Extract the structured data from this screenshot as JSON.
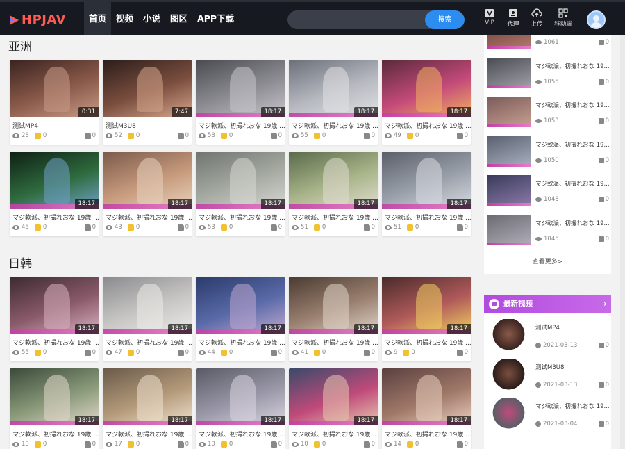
{
  "header": {
    "logo_text": "HPJAV",
    "nav": [
      "首页",
      "视频",
      "小说",
      "图区",
      "APP下载"
    ],
    "active_nav": 0,
    "search": {
      "value": "",
      "placeholder": "",
      "button": "搜索"
    },
    "tools": [
      {
        "icon": "vip-icon",
        "label": "VIP"
      },
      {
        "icon": "agent-icon",
        "label": "代理"
      },
      {
        "icon": "upload-icon",
        "label": "上传"
      },
      {
        "icon": "qrcode-icon",
        "label": "移动端"
      }
    ]
  },
  "sections": [
    {
      "title": "亚洲",
      "cards": [
        {
          "title": "测试MP4",
          "duration": "0:31",
          "views": "28",
          "coins": "0",
          "likes": "0",
          "palette": [
            "#3a2320",
            "#8a5a4a",
            "#c99a86"
          ]
        },
        {
          "title": "测试M3U8",
          "duration": "7:47",
          "views": "52",
          "coins": "0",
          "likes": "0",
          "palette": [
            "#2b1d1a",
            "#7c4f3f",
            "#d5a68d"
          ]
        },
        {
          "title": "マジ軟派、初撮れおな 19歳 ...",
          "duration": "18:17",
          "views": "58",
          "coins": "0",
          "likes": "0",
          "palette": [
            "#4a4a52",
            "#8c8c92",
            "#c9c6cc"
          ]
        },
        {
          "title": "マジ軟派、初撮れおな 19歳 ...",
          "duration": "18:17",
          "views": "55",
          "coins": "0",
          "likes": "0",
          "palette": [
            "#6b6f78",
            "#b6b9c0",
            "#e2e2e6"
          ]
        },
        {
          "title": "マジ軟派、初撮れおな 19歳 ...",
          "duration": "18:17",
          "views": "49",
          "coins": "0",
          "likes": "0",
          "palette": [
            "#5a2a3a",
            "#c44a7a",
            "#f0b060"
          ]
        },
        {
          "title": "マジ軟派、初撮れおな 19歳 ...",
          "duration": "18:17",
          "views": "45",
          "coins": "0",
          "likes": "0",
          "palette": [
            "#0e1f14",
            "#2f6b3e",
            "#6fa0c8"
          ]
        },
        {
          "title": "マジ軟派、初撮れおな 19歳 ...",
          "duration": "18:17",
          "views": "43",
          "coins": "0",
          "likes": "0",
          "palette": [
            "#7a5a4a",
            "#c79a7c",
            "#e8d2bd"
          ]
        },
        {
          "title": "マジ軟派、初撮れおな 19歳 ...",
          "duration": "18:17",
          "views": "53",
          "coins": "0",
          "likes": "0",
          "palette": [
            "#6f7470",
            "#a6aba3",
            "#d6d8d2"
          ]
        },
        {
          "title": "マジ軟派、初撮れおな 19歳 ...",
          "duration": "18:17",
          "views": "51",
          "coins": "0",
          "likes": "0",
          "palette": [
            "#5a6a4a",
            "#a9b58a",
            "#e0ddd0"
          ]
        },
        {
          "title": "マジ軟派、初撮れおな 19歳 ...",
          "duration": "18:17",
          "views": "51",
          "coins": "0",
          "likes": "0",
          "palette": [
            "#5a5e68",
            "#9aa0aa",
            "#d8dbe2"
          ]
        }
      ]
    },
    {
      "title": "日韩",
      "cards": [
        {
          "title": "マジ軟派、初撮れおな 19歳 ...",
          "duration": "18:17",
          "views": "55",
          "coins": "0",
          "likes": "0",
          "palette": [
            "#3c2a30",
            "#8a5a6a",
            "#d8b0c0"
          ]
        },
        {
          "title": "マジ軟派、初撮れおな 19歳 ...",
          "duration": "18:17",
          "views": "47",
          "coins": "0",
          "likes": "0",
          "palette": [
            "#8a8a8e",
            "#c8c6c4",
            "#ecebe8"
          ]
        },
        {
          "title": "マジ軟派、初撮れおな 19歳 ...",
          "duration": "18:17",
          "views": "44",
          "coins": "0",
          "likes": "0",
          "palette": [
            "#2a3a6a",
            "#5a6aa8",
            "#c0a8d0"
          ]
        },
        {
          "title": "マジ軟派、初撮れおな 19歳 ...",
          "duration": "18:17",
          "views": "41",
          "coins": "0",
          "likes": "0",
          "palette": [
            "#4a3a30",
            "#9a8070",
            "#e0d4c8"
          ]
        },
        {
          "title": "マジ軟派、初撮れおな 19歳 ...",
          "duration": "18:17",
          "views": "9",
          "coins": "0",
          "likes": "0",
          "palette": [
            "#4a2a2a",
            "#b05a5a",
            "#f0d060"
          ]
        },
        {
          "title": "マジ軟派、初撮れおな 19歳 ...",
          "duration": "18:17",
          "views": "10",
          "coins": "0",
          "likes": "0",
          "palette": [
            "#3a4a3a",
            "#8a9a7a",
            "#e4d8cc"
          ]
        },
        {
          "title": "マジ軟派、初撮れおな 19歳 ...",
          "duration": "18:17",
          "views": "17",
          "coins": "0",
          "likes": "0",
          "palette": [
            "#6a5a4a",
            "#b49a7a",
            "#f0e2d0"
          ]
        },
        {
          "title": "マジ軟派、初撮れおな 19歳 ...",
          "duration": "18:17",
          "views": "10",
          "coins": "0",
          "likes": "0",
          "palette": [
            "#5a5a66",
            "#9a98a8",
            "#dad6e0"
          ]
        },
        {
          "title": "マジ軟派、初撮れおな 19歳 ...",
          "duration": "18:17",
          "views": "10",
          "coins": "0",
          "likes": "0",
          "palette": [
            "#3a4a6a",
            "#c04a7a",
            "#e8c8b0"
          ]
        },
        {
          "title": "マジ軟派、初撮れおな 19歳 ...",
          "duration": "18:17",
          "views": "14",
          "coins": "0",
          "likes": "0",
          "palette": [
            "#5a4040",
            "#a07868",
            "#ead0c0"
          ]
        }
      ]
    }
  ],
  "sidebar": {
    "ranking": [
      {
        "title": "",
        "views": "1061",
        "likes": "0",
        "palette": [
          "#6a3a3a",
          "#b07a6a"
        ]
      },
      {
        "title": "マジ軟派、初撮れおな 19...",
        "views": "1055",
        "likes": "0",
        "palette": [
          "#4a4a52",
          "#a0a0a8"
        ]
      },
      {
        "title": "マジ軟派、初撮れおな 19...",
        "views": "1053",
        "likes": "0",
        "palette": [
          "#7a5a5a",
          "#c8a090"
        ]
      },
      {
        "title": "マジ軟派、初撮れおな 19...",
        "views": "1050",
        "likes": "0",
        "palette": [
          "#5a6070",
          "#a8b0c0"
        ]
      },
      {
        "title": "マジ軟派、初撮れおな 19...",
        "views": "1048",
        "likes": "0",
        "palette": [
          "#3a3a5a",
          "#8a7aa8"
        ]
      },
      {
        "title": "マジ軟派、初撮れおな 19...",
        "views": "1045",
        "likes": "0",
        "palette": [
          "#6a6a72",
          "#b0aeb8"
        ]
      }
    ],
    "more": "查看更多>",
    "latest_title": "最新视频",
    "latest": [
      {
        "title": "测试MP4",
        "date": "2021-03-13",
        "likes": "0",
        "palette": [
          "#3a2320",
          "#8a5a4a"
        ]
      },
      {
        "title": "测试M3U8",
        "date": "2021-03-13",
        "likes": "0",
        "palette": [
          "#2b1d1a",
          "#7c4f3f"
        ]
      },
      {
        "title": "マジ軟派、初撮れおな 19...",
        "date": "2021-03-04",
        "likes": "0",
        "palette": [
          "#5a5e68",
          "#c04a7a"
        ]
      }
    ]
  },
  "colors": {
    "header_bg": "#16191f",
    "accent": "#2d8cf0",
    "logo": "#ff5b53",
    "latest_header": "#b24be0"
  }
}
